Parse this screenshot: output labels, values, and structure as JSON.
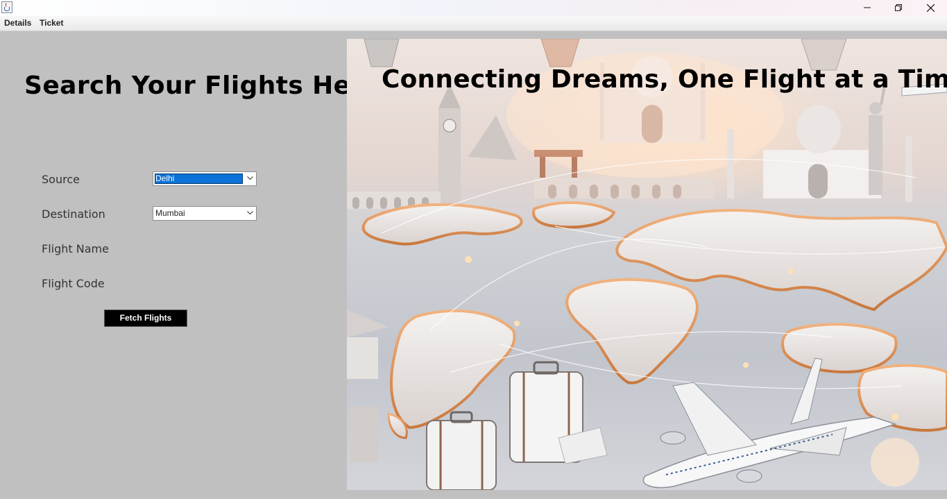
{
  "menu": {
    "items": [
      "Details",
      "Ticket"
    ]
  },
  "search": {
    "heading": "Search Your Flights Here",
    "source_label": "Source",
    "source_value": "Delhi",
    "destination_label": "Destination",
    "destination_value": "Mumbai",
    "flight_name_label": "Flight Name",
    "flight_code_label": "Flight Code",
    "fetch_button": "Fetch Flights"
  },
  "hero": {
    "title": "Connecting Dreams, One Flight at a Time"
  },
  "colors": {
    "panel_bg": "#c0c0c0",
    "button_bg": "#000000",
    "selection": "#0a72d8"
  }
}
